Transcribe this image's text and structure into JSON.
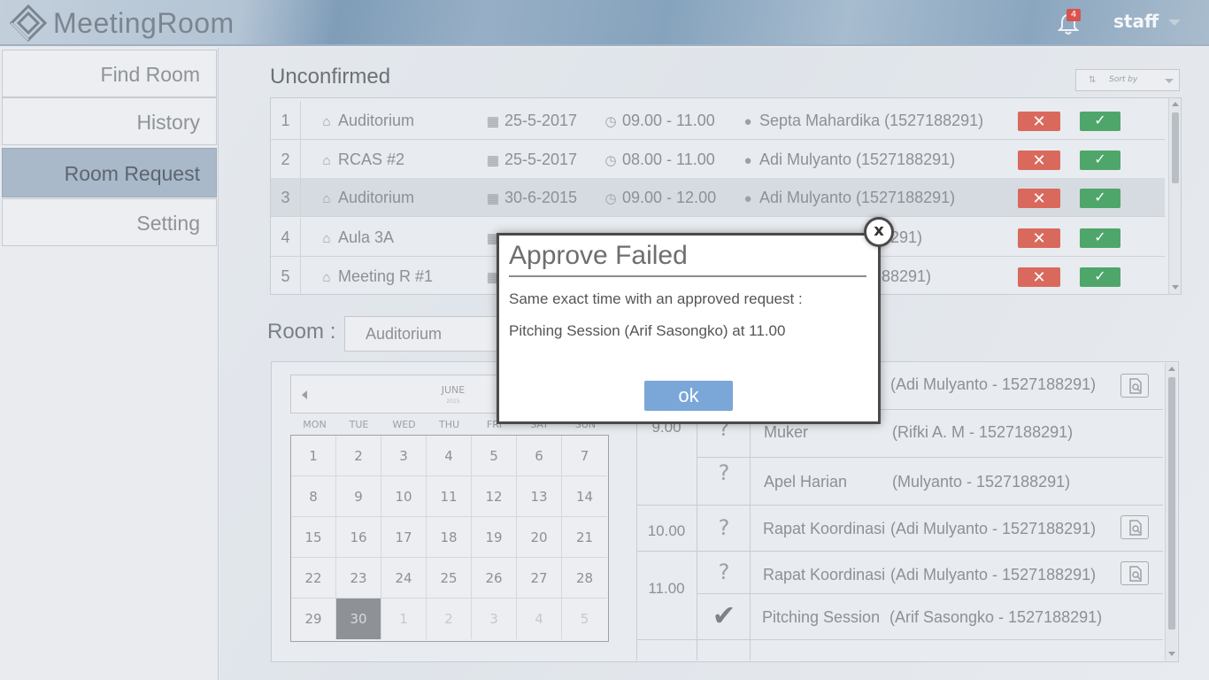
{
  "app": {
    "name": "MeetingRoom"
  },
  "header": {
    "notification_count": "4",
    "user": "staff"
  },
  "sidebar": {
    "items": [
      {
        "label": "Find Room"
      },
      {
        "label": "History"
      },
      {
        "label": "Room Request"
      },
      {
        "label": "Setting"
      }
    ]
  },
  "unconfirmed": {
    "title": "Unconfirmed",
    "sort_label": "Sort by",
    "rows": [
      {
        "num": "1",
        "room": "Auditorium",
        "date": "25-5-2017",
        "time": "09.00 - 11.00",
        "requester": "Septa Mahardika (1527188291)"
      },
      {
        "num": "2",
        "room": "RCAS #2",
        "date": "25-5-2017",
        "time": "08.00 - 11.00",
        "requester": "Adi Mulyanto (1527188291)"
      },
      {
        "num": "3",
        "room": "Auditorium",
        "date": "30-6-2015",
        "time": "09.00 - 12.00",
        "requester": "Adi Mulyanto (1527188291)"
      },
      {
        "num": "4",
        "room": "Aula 3A",
        "date": "",
        "time": "",
        "requester": "291)"
      },
      {
        "num": "5",
        "room": "Meeting R #1",
        "date": "",
        "time": "",
        "requester": "88291)"
      }
    ]
  },
  "room_filter": {
    "label": "Room :",
    "value": "Auditorium"
  },
  "calendar": {
    "month": "JUNE",
    "year": "2015",
    "weekdays": [
      "MON",
      "TUE",
      "WED",
      "THU",
      "FRI",
      "SAT",
      "SUN"
    ],
    "days": [
      [
        "1",
        "2",
        "3",
        "4",
        "5",
        "6",
        "7"
      ],
      [
        "8",
        "9",
        "10",
        "11",
        "12",
        "13",
        "14"
      ],
      [
        "15",
        "16",
        "17",
        "18",
        "19",
        "20",
        "21"
      ],
      [
        "22",
        "23",
        "24",
        "25",
        "26",
        "27",
        "28"
      ],
      [
        "29",
        "30",
        "1",
        "2",
        "3",
        "4",
        "5"
      ]
    ],
    "selected": "30"
  },
  "schedule": {
    "times": [
      "9.00",
      "10.00",
      "11.00"
    ],
    "entries": [
      {
        "status": "?",
        "event": "",
        "person": "(Adi Mulyanto - 1527188291)"
      },
      {
        "status": "?",
        "event": "Muker",
        "person": "(Rifki A. M - 1527188291)"
      },
      {
        "status": "?",
        "event": "Apel Harian",
        "person": "(Mulyanto - 1527188291)"
      },
      {
        "status": "?",
        "event": "Rapat Koordinasi",
        "person": "(Adi Mulyanto - 1527188291)"
      },
      {
        "status": "?",
        "event": "Rapat Koordinasi",
        "person": "(Adi Mulyanto - 1527188291)"
      },
      {
        "status": "✔",
        "event": "Pitching Session",
        "person": "(Arif Sasongko - 1527188291)"
      }
    ]
  },
  "modal": {
    "title": "Approve Failed",
    "message": "Same exact time with an approved request :",
    "detail": "Pitching Session (Arif Sasongko) at 11.00",
    "ok_label": "ok",
    "close_label": "x"
  },
  "colors": {
    "reject": "#d9695c",
    "approve": "#4fa66a",
    "ok_button": "#7aa7d8",
    "sidebar_active": "#a9b9ca"
  }
}
